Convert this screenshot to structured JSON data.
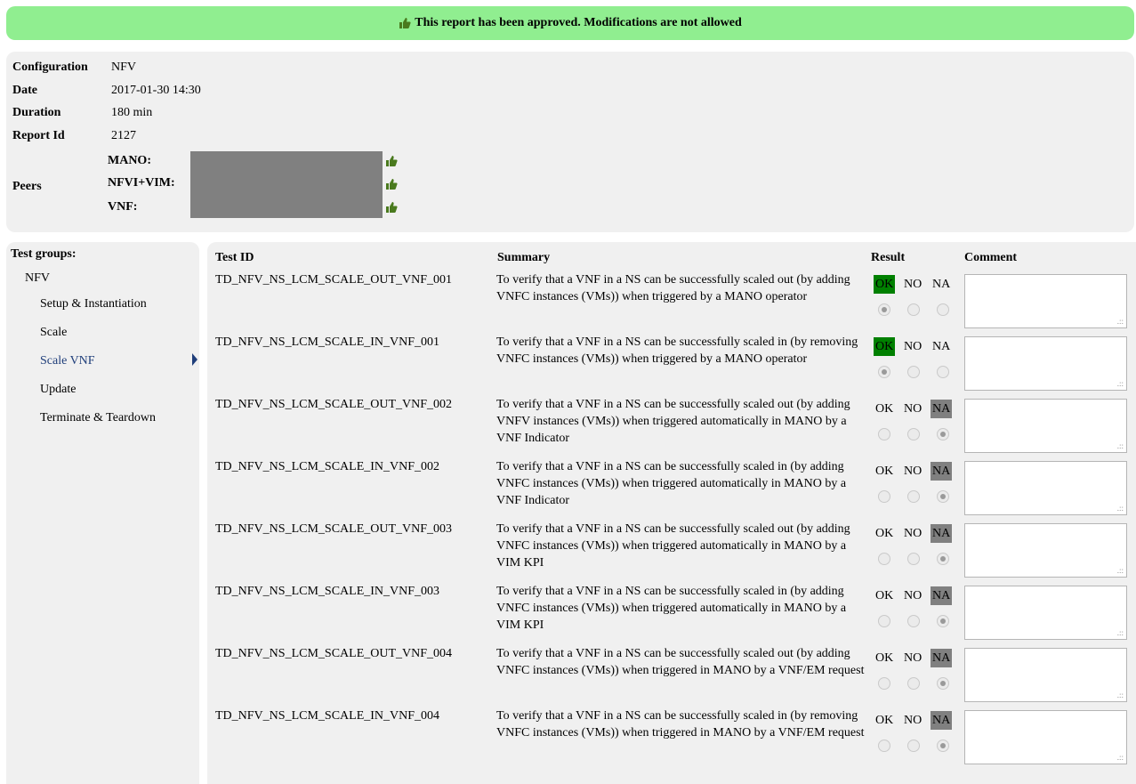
{
  "banner": {
    "text": "This report has been approved. Modifications are not allowed",
    "icon": "thumbs-up-icon"
  },
  "info": {
    "configuration": {
      "label": "Configuration",
      "value": "NFV"
    },
    "date": {
      "label": "Date",
      "value": "2017-01-30 14:30"
    },
    "duration": {
      "label": "Duration",
      "value": "180 min"
    },
    "report_id": {
      "label": "Report Id",
      "value": "2127"
    },
    "peers": {
      "label": "Peers",
      "items": [
        {
          "label": "MANO:"
        },
        {
          "label": "NFVI+VIM:"
        },
        {
          "label": "VNF:"
        }
      ]
    }
  },
  "sidebar": {
    "header": "Test groups:",
    "group": "NFV",
    "items": [
      "Setup & Instantiation",
      "Scale",
      "Scale VNF",
      "Update",
      "Terminate & Teardown"
    ],
    "active_index": 2
  },
  "table": {
    "headers": {
      "test_id": "Test ID",
      "summary": "Summary",
      "result": "Result",
      "comment": "Comment"
    },
    "option_labels": {
      "ok": "OK",
      "no": "NO",
      "na": "NA"
    },
    "rows": [
      {
        "id": "TD_NFV_NS_LCM_SCALE_OUT_VNF_001",
        "summary": "To verify that a VNF in a NS can be successfully scaled out (by adding VNFC instances (VMs)) when triggered by a MANO operator",
        "result": "OK",
        "comment": ""
      },
      {
        "id": "TD_NFV_NS_LCM_SCALE_IN_VNF_001",
        "summary": "To verify that a VNF in a NS can be successfully scaled in (by removing VNFC instances (VMs)) when triggered by a MANO operator",
        "result": "OK",
        "comment": ""
      },
      {
        "id": "TD_NFV_NS_LCM_SCALE_OUT_VNF_002",
        "summary": "To verify that a VNF in a NS can be successfully scaled out (by adding VNFV instances (VMs)) when triggered automatically in MANO by a VNF Indicator",
        "result": "NA",
        "comment": ""
      },
      {
        "id": "TD_NFV_NS_LCM_SCALE_IN_VNF_002",
        "summary": "To verify that a VNF in a NS can be successfully scaled in (by adding VNFC instances (VMs)) when triggered automatically in MANO by a VNF Indicator",
        "result": "NA",
        "comment": ""
      },
      {
        "id": "TD_NFV_NS_LCM_SCALE_OUT_VNF_003",
        "summary": "To verify that a VNF in a NS can be successfully scaled out (by adding VNFC instances (VMs)) when triggered automatically in MANO by a VIM KPI",
        "result": "NA",
        "comment": ""
      },
      {
        "id": "TD_NFV_NS_LCM_SCALE_IN_VNF_003",
        "summary": "To verify that a VNF in a NS can be successfully scaled in (by adding VNFC instances (VMs)) when triggered automatically in MANO by a VIM KPI",
        "result": "NA",
        "comment": ""
      },
      {
        "id": "TD_NFV_NS_LCM_SCALE_OUT_VNF_004",
        "summary": "To verify that a VNF in a NS can be successfully scaled out (by adding VNFC instances (VMs)) when triggered in MANO by a VNF/EM request",
        "result": "NA",
        "comment": ""
      },
      {
        "id": "TD_NFV_NS_LCM_SCALE_IN_VNF_004",
        "summary": "To verify that a VNF in a NS can be successfully scaled in (by removing VNFC instances (VMs)) when triggered in MANO by a VNF/EM request",
        "result": "NA",
        "comment": ""
      }
    ]
  },
  "colors": {
    "banner_bg": "#90ee90",
    "panel_bg": "#f0f0f0",
    "ok_selected": "#008000",
    "na_selected": "#808080",
    "thumb": "#4a7a1e",
    "active_link": "#1f3e7a",
    "redaction": "#808080"
  }
}
